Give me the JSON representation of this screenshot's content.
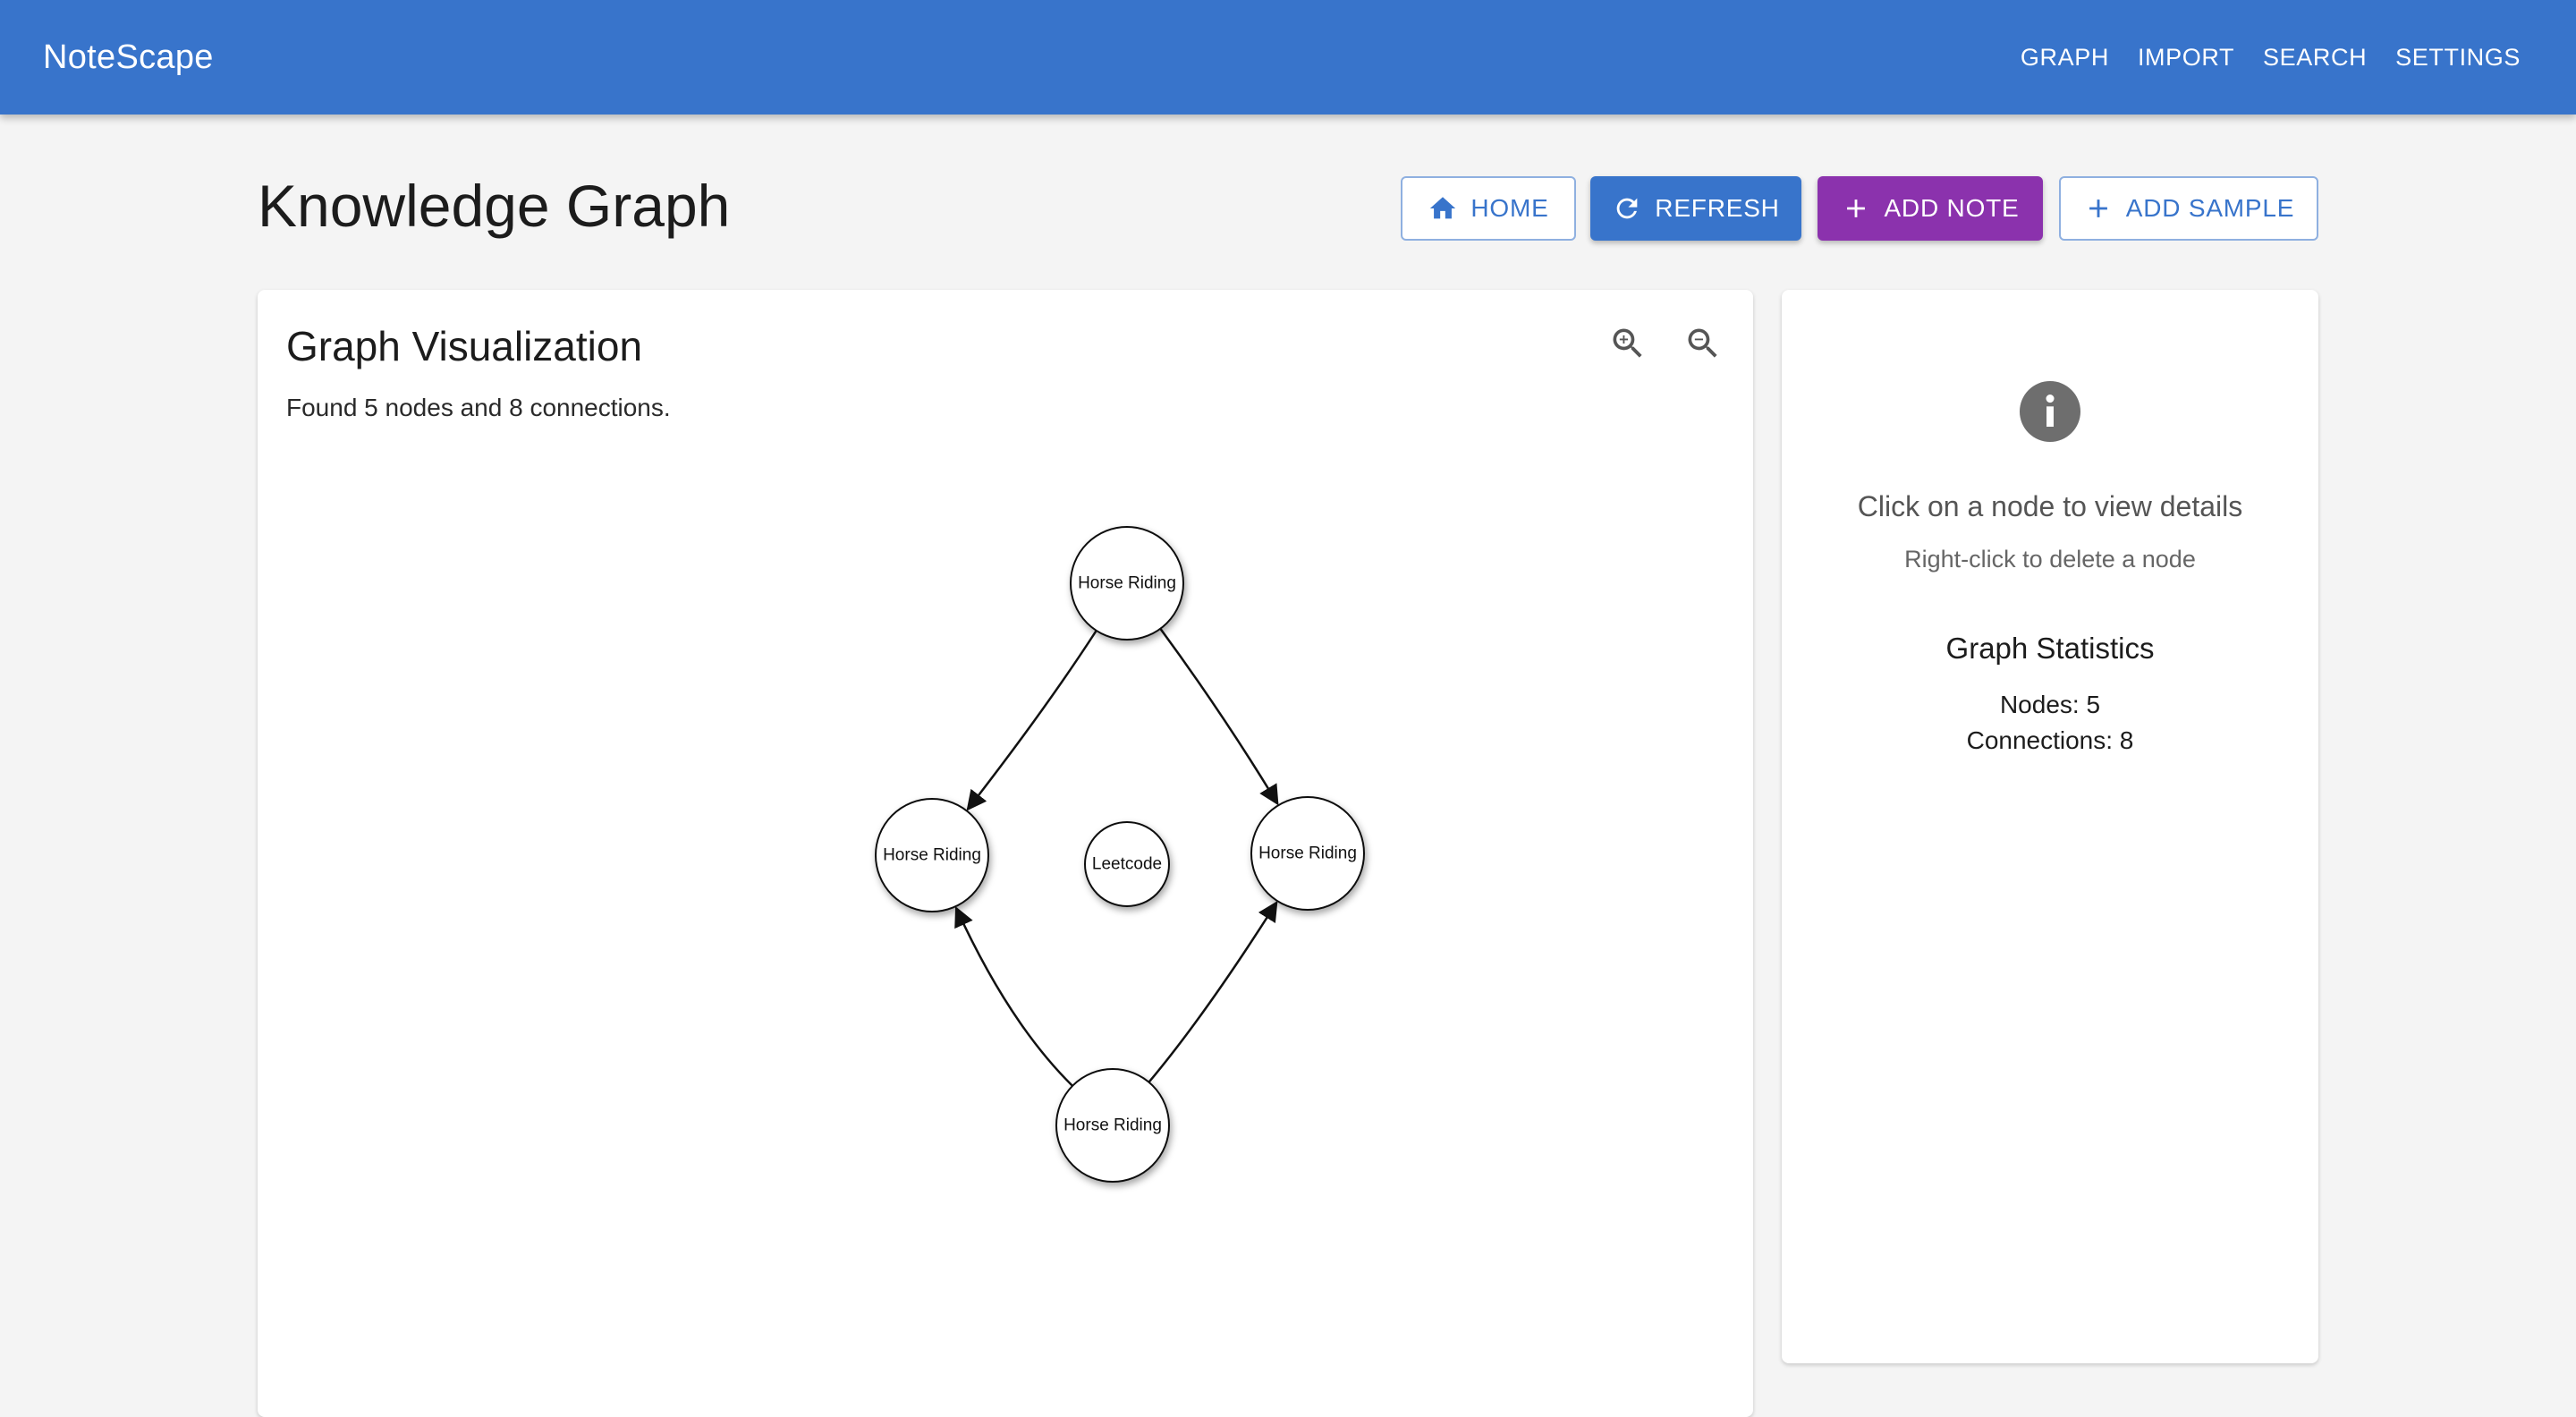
{
  "app": {
    "brand": "NoteScape",
    "nav": [
      "GRAPH",
      "IMPORT",
      "SEARCH",
      "SETTINGS"
    ]
  },
  "page": {
    "title": "Knowledge Graph",
    "actions": {
      "home": "HOME",
      "refresh": "REFRESH",
      "add_note": "ADD NOTE",
      "add_sample": "ADD SAMPLE"
    }
  },
  "graph_panel": {
    "title": "Graph Visualization",
    "summary": "Found 5 nodes and 8 connections.",
    "zoom_in_icon": "zoom-in-icon",
    "zoom_out_icon": "zoom-out-icon",
    "nodes": [
      {
        "id": "top",
        "label": "Horse Riding"
      },
      {
        "id": "left",
        "label": "Horse Riding"
      },
      {
        "id": "center",
        "label": "Leetcode"
      },
      {
        "id": "right",
        "label": "Horse Riding"
      },
      {
        "id": "bottom",
        "label": "Horse Riding"
      }
    ],
    "edges": [
      {
        "from": "top",
        "to": "left"
      },
      {
        "from": "top",
        "to": "right"
      },
      {
        "from": "bottom",
        "to": "left"
      },
      {
        "from": "bottom",
        "to": "right"
      }
    ]
  },
  "details_panel": {
    "icon": "info-icon",
    "hint": "Click on a node to view details",
    "subhint": "Right-click to delete a node",
    "stats_title": "Graph Statistics",
    "nodes_stat": "Nodes: 5",
    "connections_stat": "Connections: 8"
  },
  "colors": {
    "appbar": "#3874cb",
    "primary": "#3874cb",
    "secondary": "#8b32ad",
    "background": "#f4f4f4"
  }
}
